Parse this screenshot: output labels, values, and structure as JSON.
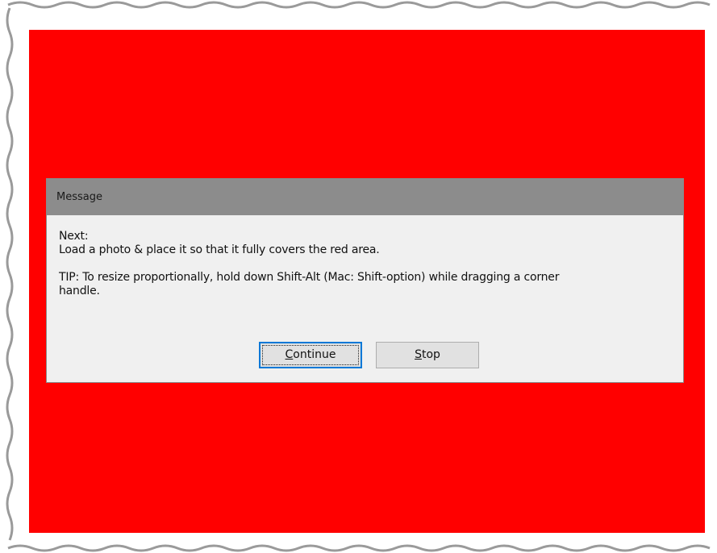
{
  "dialog": {
    "title": "Message",
    "line1": "Next:",
    "line2": "Load a photo & place it so that it fully covers the red area.",
    "tip_line1": "TIP: To resize proportionally, hold down Shift-Alt (Mac: Shift-option) while dragging a corner",
    "tip_line2": "handle.",
    "continue_mnemonic": "C",
    "continue_rest": "ontinue",
    "stop_mnemonic": "S",
    "stop_rest": "top"
  },
  "colors": {
    "canvas": "#ff0000",
    "titlebar": "#8c8c8c",
    "dialog_bg": "#f0f0f0",
    "focus": "#0078d7"
  }
}
